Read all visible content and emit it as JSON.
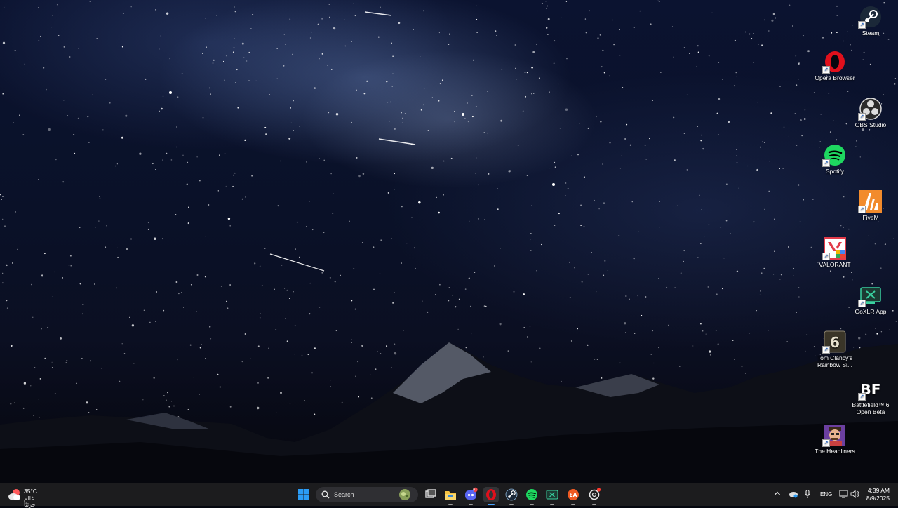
{
  "desktop": {
    "icons": [
      {
        "label": "Steam",
        "icon": "steam-icon"
      },
      {
        "label": "Opera Browser",
        "icon": "opera-icon"
      },
      {
        "label": "OBS Studio",
        "icon": "obs-icon"
      },
      {
        "label": "Spotify",
        "icon": "spotify-icon"
      },
      {
        "label": "FiveM",
        "icon": "fivem-icon"
      },
      {
        "label": "VALORANT",
        "icon": "valorant-icon"
      },
      {
        "label": "GoXLR App",
        "icon": "goxlr-icon"
      },
      {
        "label": "Tom Clancy's Rainbow Si...",
        "icon": "rainbow-six-icon"
      },
      {
        "label": "Battlefield™ 6 Open Beta",
        "icon": "battlefield-icon"
      },
      {
        "label": "The Headliners",
        "icon": "headliners-icon"
      }
    ]
  },
  "taskbar": {
    "weather": {
      "temp": "35°C",
      "desc": "غالم جزئيًا",
      "icon": "weather-cloud-icon"
    },
    "search": {
      "placeholder": "Search"
    },
    "pinned": [
      {
        "name": "start-button",
        "icon": "windows-icon"
      },
      {
        "name": "task-view",
        "icon": "task-view-icon"
      },
      {
        "name": "file-explorer",
        "icon": "folder-icon"
      },
      {
        "name": "discord",
        "icon": "discord-icon",
        "badge": "9+"
      },
      {
        "name": "opera",
        "icon": "opera-icon"
      },
      {
        "name": "steam",
        "icon": "steam-icon"
      },
      {
        "name": "spotify",
        "icon": "spotify-icon"
      },
      {
        "name": "goxlr",
        "icon": "goxlr-icon"
      },
      {
        "name": "ea-app",
        "icon": "ea-icon"
      },
      {
        "name": "chatgpt",
        "icon": "chatgpt-icon"
      }
    ],
    "tray": {
      "language": "ENG"
    },
    "clock": {
      "time": "4:39 AM",
      "date": "8/9/2025"
    }
  },
  "colors": {
    "taskbar_bg": "#1c1c1e",
    "accent": "#0a84ff",
    "spotify": "#1ed760",
    "opera": "#e0101c"
  }
}
